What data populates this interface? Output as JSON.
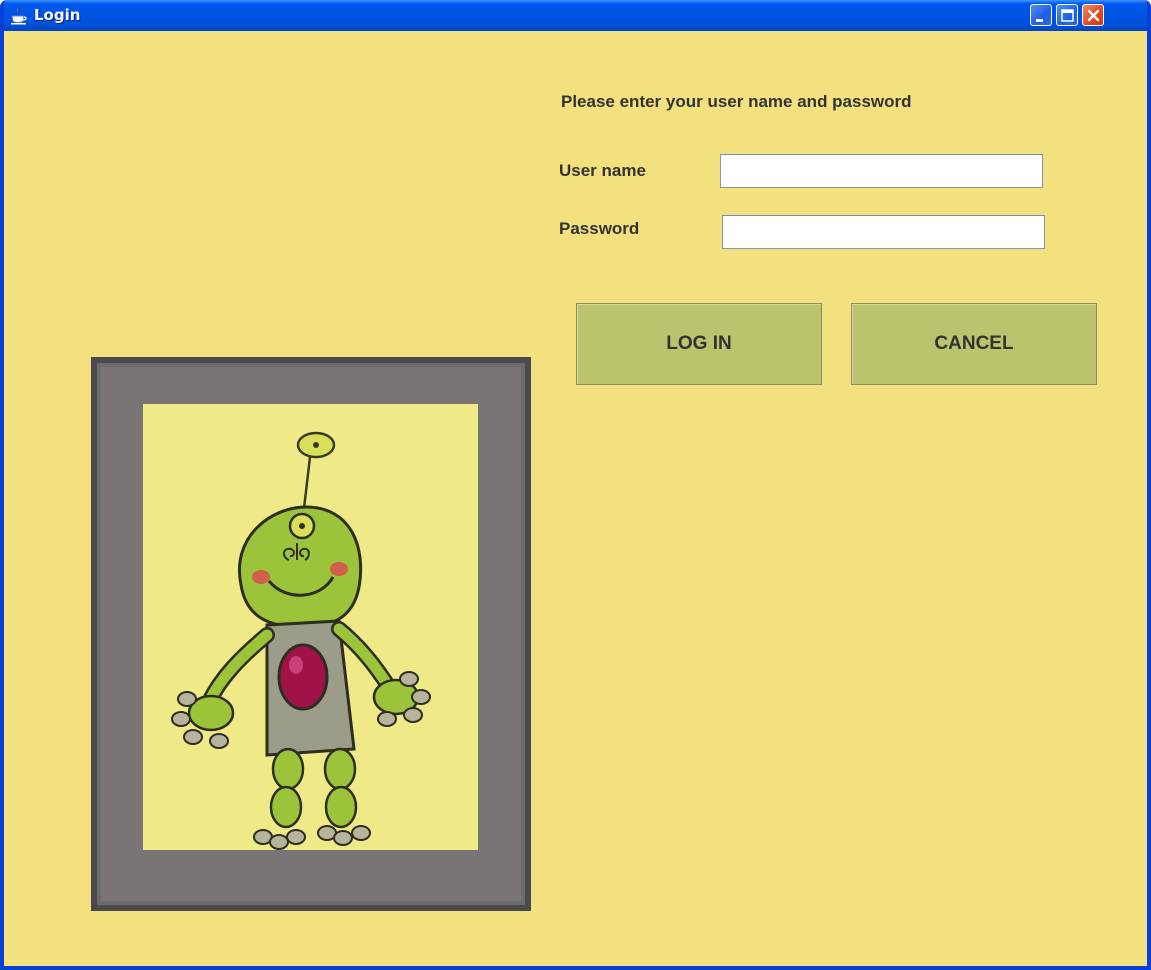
{
  "window": {
    "title": "Login",
    "controls": [
      "minimize-icon",
      "maximize-icon",
      "close-icon"
    ]
  },
  "form": {
    "prompt": "Please enter your user name and password",
    "username_label": "User name",
    "username_value": "",
    "password_label": "Password",
    "password_value": ""
  },
  "buttons": {
    "login_label": "LOG IN",
    "cancel_label": "CANCEL"
  },
  "colors": {
    "background": "#f3e07e",
    "button": "#bbc46d",
    "titlebar": "#0055e5",
    "frame": "#757072",
    "robot_green": "#9cc43a",
    "robot_heart": "#a01248"
  },
  "picture": {
    "subject": "framed robot painting"
  }
}
